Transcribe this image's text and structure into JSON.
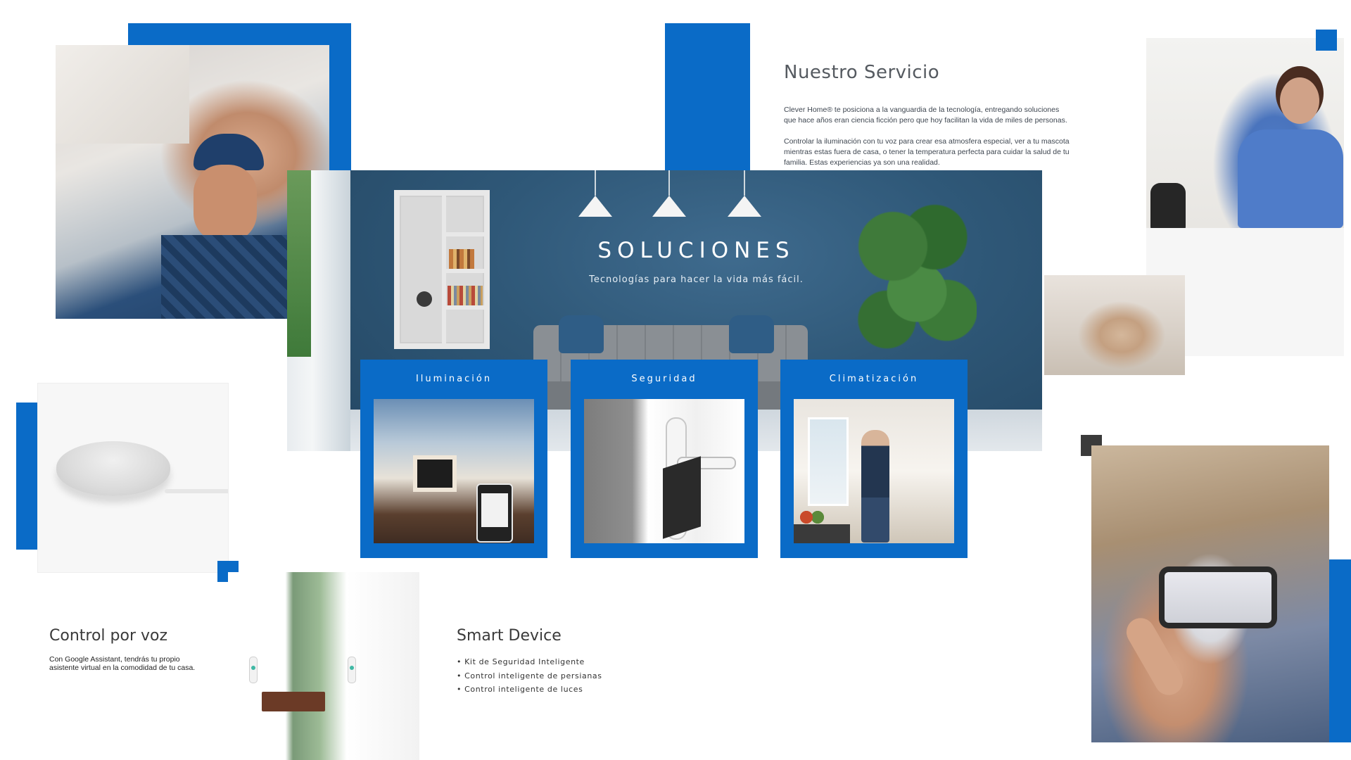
{
  "colors": {
    "accent_blue": "#0a6bc7",
    "dark_accent": "#3b3b3b",
    "hero_blue": "#2f5878",
    "text_gray": "#555a60"
  },
  "nuestro_servicio": {
    "title": "Nuestro Servicio",
    "paragraph_1_line_1": "Clever Home® te posiciona a la vanguardia de la tecnología, entregando soluciones",
    "paragraph_1_line_2": "que hace  años eran ciencia ficción pero que hoy facilitan la vida de miles de personas.",
    "paragraph_2_line_1": "Controlar la iluminación con tu voz para crear esa atmosfera especial, ver a tu mascota",
    "paragraph_2_line_2": "mientras estas fuera de casa, o tener la temperatura perfecta para cuidar la salud de tu",
    "paragraph_2_line_3": "familia. Estas experiencias ya son una realidad."
  },
  "hero": {
    "title": "SOLUCIONES",
    "subtitle": "Tecnologías para hacer la vida más fácil."
  },
  "cards": [
    {
      "title": "Iluminación",
      "image": "smart-home-living-room-photo"
    },
    {
      "title": "Seguridad",
      "image": "smart-lock-door-photo"
    },
    {
      "title": "Climatización",
      "image": "man-with-tablet-kitchen-photo"
    }
  ],
  "control_por_voz": {
    "title": "Control por voz",
    "text_line_1": "Con Google Assistant, tendrás tu propio",
    "text_line_2": "asistente virtual en la comodidad de tu casa."
  },
  "smart_device": {
    "title": "Smart Device",
    "items": [
      "Kit de Seguridad Inteligente",
      "Control inteligente de persianas",
      "Control inteligente de luces"
    ]
  },
  "images": {
    "technician": "technician-installing-air-conditioner-photo",
    "woman_with_speaker": "woman-with-smart-speaker-photo",
    "family": "mother-and-child-by-window-photo",
    "smart_speaker": "google-nest-mini-speaker-photo",
    "door_sensor": "door-sensor-living-room-photo",
    "phone_control": "hands-holding-smartphone-app-photo"
  }
}
